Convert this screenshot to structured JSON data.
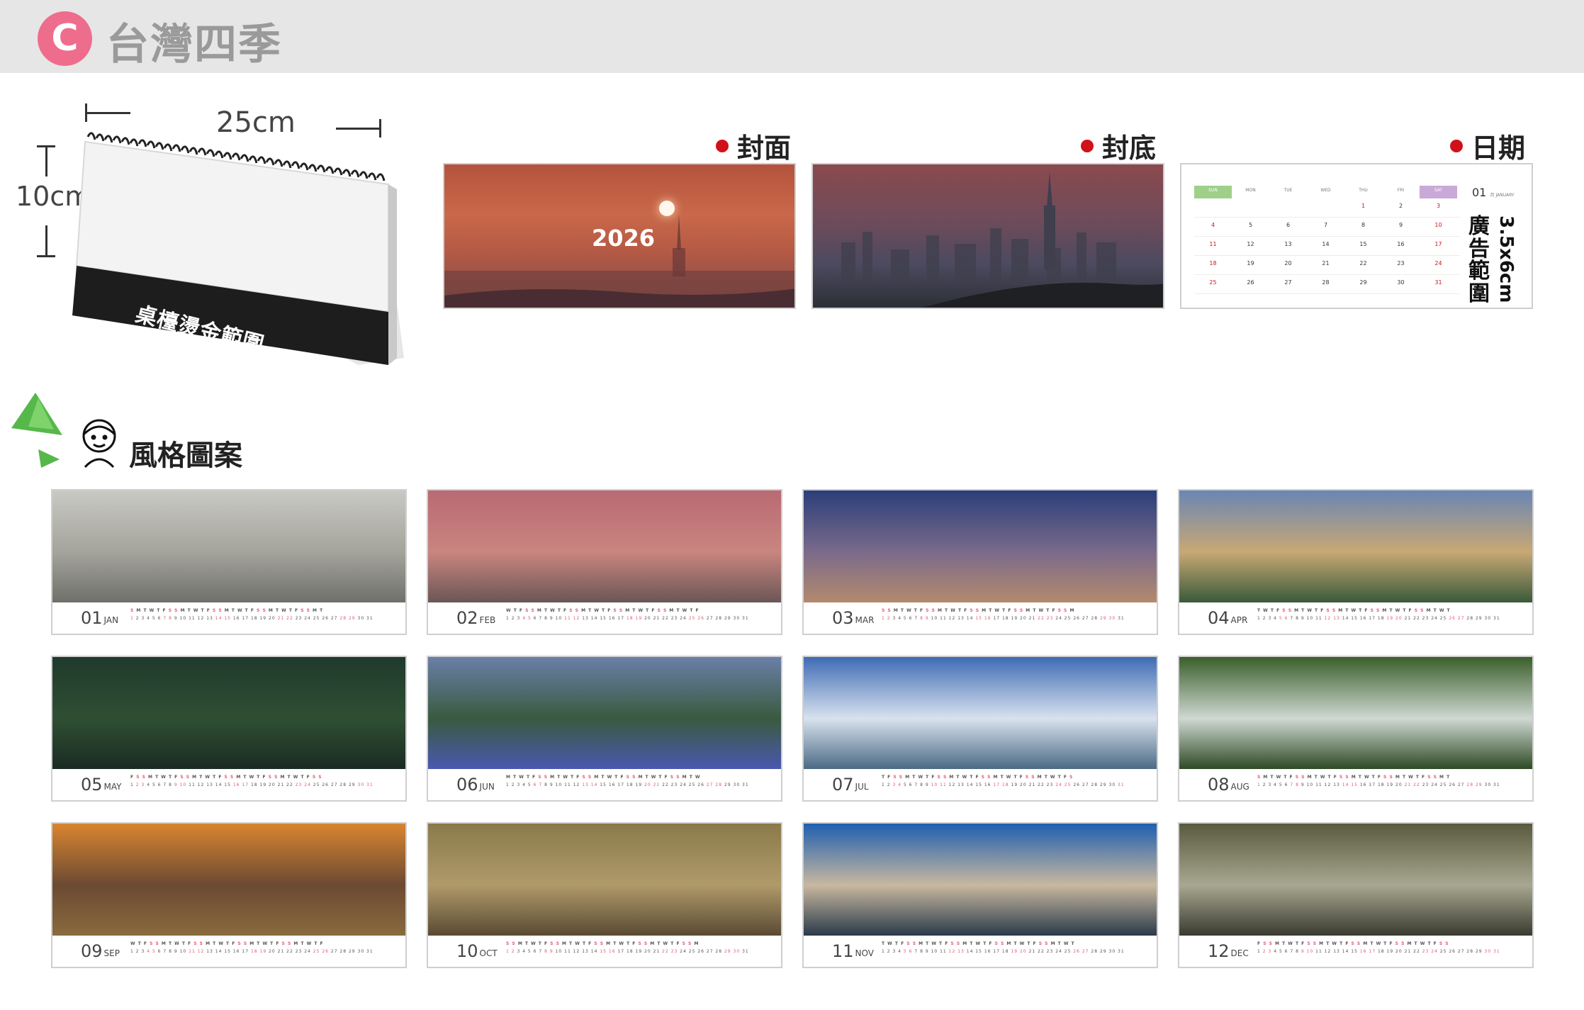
{
  "header": {
    "badge": "C",
    "title": "台灣四季"
  },
  "product": {
    "width_label": "25cm",
    "height_label": "10cm",
    "foil_label": "桌檯燙金範圍"
  },
  "previews": {
    "cover_label": "封面",
    "back_label": "封底",
    "date_label": "日期",
    "cover_year": "2026"
  },
  "date_panel": {
    "month_num": "01",
    "month_name": "月 JANUARY",
    "ad_text": "廣告範圍",
    "ad_size": "3.5x6cm",
    "weekdays": [
      "SUN",
      "MON",
      "TUE",
      "WED",
      "THU",
      "FRI",
      "SAT"
    ],
    "weeks": [
      [
        "",
        "",
        "",
        "",
        "1",
        "2",
        "3"
      ],
      [
        "4",
        "5",
        "6",
        "7",
        "8",
        "9",
        "10"
      ],
      [
        "11",
        "12",
        "13",
        "14",
        "15",
        "16",
        "17"
      ],
      [
        "18",
        "19",
        "20",
        "21",
        "22",
        "23",
        "24"
      ],
      [
        "25",
        "26",
        "27",
        "28",
        "29",
        "30",
        "31"
      ]
    ]
  },
  "section": {
    "title": "風格圖案"
  },
  "months": [
    {
      "num": "01",
      "abbr": "JAN",
      "colors": [
        "#c9c9c4",
        "#a4a49c",
        "#6f706a"
      ]
    },
    {
      "num": "02",
      "abbr": "FEB",
      "colors": [
        "#b96a73",
        "#c9857f",
        "#6b5656"
      ]
    },
    {
      "num": "03",
      "abbr": "MAR",
      "colors": [
        "#2b3e7a",
        "#7a6a8a",
        "#b48a6e"
      ]
    },
    {
      "num": "04",
      "abbr": "APR",
      "colors": [
        "#6a86b4",
        "#c8a874",
        "#3a5a3a"
      ]
    },
    {
      "num": "05",
      "abbr": "MAY",
      "colors": [
        "#1f3a2c",
        "#2f4f33",
        "#1a2b22"
      ]
    },
    {
      "num": "06",
      "abbr": "JUN",
      "colors": [
        "#6a7fa8",
        "#3a5a3f",
        "#4a58b0"
      ]
    },
    {
      "num": "07",
      "abbr": "JUL",
      "colors": [
        "#3f6bb5",
        "#d8e2ee",
        "#4b6a86"
      ]
    },
    {
      "num": "08",
      "abbr": "AUG",
      "colors": [
        "#3a5f2b",
        "#cfd8d2",
        "#2e4a24"
      ]
    },
    {
      "num": "09",
      "abbr": "SEP",
      "colors": [
        "#d9852f",
        "#6b4a33",
        "#8a6a3e"
      ]
    },
    {
      "num": "10",
      "abbr": "OCT",
      "colors": [
        "#8a7a4a",
        "#b09a6a",
        "#5a4a34"
      ]
    },
    {
      "num": "11",
      "abbr": "NOV",
      "colors": [
        "#1f5fb0",
        "#c8b8a0",
        "#2a3a4a"
      ]
    },
    {
      "num": "12",
      "abbr": "DEC",
      "colors": [
        "#5a5a40",
        "#a8a890",
        "#3a3a30"
      ]
    }
  ]
}
